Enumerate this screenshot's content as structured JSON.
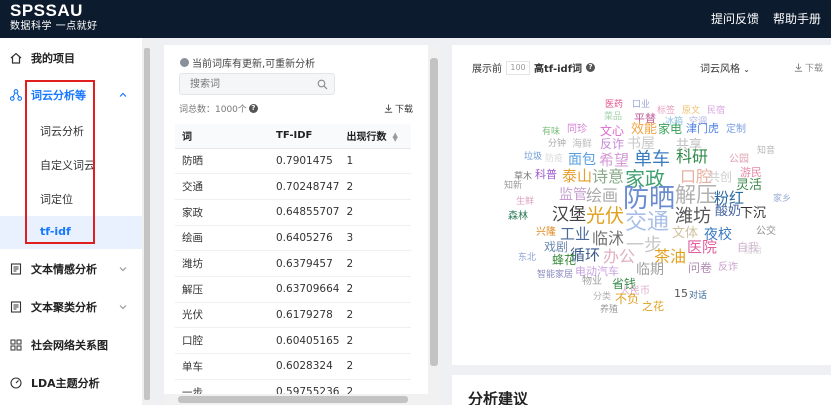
{
  "header": {
    "brand": "SPSSAU",
    "slogan": "数据科学 一点就好",
    "links": [
      "提问反馈",
      "帮助手册"
    ]
  },
  "sidebar": {
    "my_project": "我的项目",
    "group_active": "词云分析等",
    "sub_items": [
      "词云分析",
      "自定义词云",
      "词定位",
      "tf-idf"
    ],
    "groups": [
      "文本情感分析",
      "文本聚类分析",
      "社会网络关系图",
      "LDA主题分析"
    ]
  },
  "middle": {
    "notice": "当前词库有更新,可重新分析",
    "search_placeholder": "搜索词",
    "total": "词总数：1000个",
    "download": "下载",
    "columns": [
      "词",
      "TF-IDF",
      "出现行数"
    ],
    "rows": [
      [
        "防晒",
        "0.7901475",
        "1"
      ],
      [
        "交通",
        "0.70248747",
        "2"
      ],
      [
        "家政",
        "0.64855707",
        "2"
      ],
      [
        "绘画",
        "0.6405276",
        "3"
      ],
      [
        "潍坊",
        "0.6379457",
        "2"
      ],
      [
        "解压",
        "0.63709664",
        "2"
      ],
      [
        "光伏",
        "0.6179278",
        "2"
      ],
      [
        "口腔",
        "0.60405165",
        "2"
      ],
      [
        "单车",
        "0.6028324",
        "2"
      ],
      [
        "一步",
        "0.59755236",
        "2"
      ]
    ]
  },
  "right": {
    "show_prefix": "展示前",
    "show_count": "100",
    "show_suffix": "高tf-idf词",
    "style": "词云风格",
    "download": "下载",
    "analysis_title": "分析建议"
  },
  "cloud": {
    "words": [
      {
        "t": "医药",
        "c": "#e54d8a"
      },
      {
        "t": "口业",
        "c": "#9aa3d6"
      },
      {
        "t": "标签",
        "c": "#e9a0c0"
      },
      {
        "t": "原文",
        "c": "#f0c070"
      },
      {
        "t": "民宿",
        "c": "#d9a7e0"
      },
      {
        "t": "菜品",
        "c": "#a0d0a8"
      },
      {
        "t": "平替",
        "c": "#c05a9a"
      },
      {
        "t": "冰箱",
        "c": "#8fc2e0"
      },
      {
        "t": "空调",
        "c": "#b5b5e0"
      },
      {
        "t": "有味",
        "c": "#7fbf7f"
      },
      {
        "t": "同珍",
        "c": "#d37fd3"
      },
      {
        "t": "文心",
        "c": "#e06ad0"
      },
      {
        "t": "效能",
        "c": "#f2a340"
      },
      {
        "t": "家电",
        "c": "#3aa05a"
      },
      {
        "t": "津门虎",
        "c": "#4b7fe0"
      },
      {
        "t": "定制",
        "c": "#7a9fe0"
      },
      {
        "t": "分钟",
        "c": "#a7a7a7"
      },
      {
        "t": "海鲜",
        "c": "#bcbcbc"
      },
      {
        "t": "反诈",
        "c": "#c58ad8"
      },
      {
        "t": "书屋",
        "c": "#c9c9c9"
      },
      {
        "t": "共享",
        "c": "#bfbfbf"
      },
      {
        "t": "知音",
        "c": "#b8b8b8"
      },
      {
        "t": "垃圾",
        "c": "#6a9ad8"
      },
      {
        "t": "防疫",
        "c": "#dadada"
      },
      {
        "t": "面包",
        "c": "#5aa0e0"
      },
      {
        "t": "希望",
        "c": "#d59ad4"
      },
      {
        "t": "单车",
        "c": "#3a7ec0"
      },
      {
        "t": "科研",
        "c": "#2f8a4a"
      },
      {
        "t": "公园",
        "c": "#e0a0b0"
      },
      {
        "t": "草木",
        "c": "#777777"
      },
      {
        "t": "科普",
        "c": "#a05ad0"
      },
      {
        "t": "泰山",
        "c": "#e6a030"
      },
      {
        "t": "诗意",
        "c": "#8aaa8a"
      },
      {
        "t": "家政",
        "c": "#40a070"
      },
      {
        "t": "口腔",
        "c": "#e8b0a0"
      },
      {
        "t": "共创",
        "c": "#cccccc"
      },
      {
        "t": "游民",
        "c": "#e68aa8"
      },
      {
        "t": "灵活",
        "c": "#3a8a4a"
      },
      {
        "t": "知新",
        "c": "#999999"
      },
      {
        "t": "监管",
        "c": "#c8a0d0"
      },
      {
        "t": "绘画",
        "c": "#aaaaaa"
      },
      {
        "t": "防晒",
        "c": "#6a8cd0"
      },
      {
        "t": "解压",
        "c": "#b0b0b0"
      },
      {
        "t": "粉红",
        "c": "#2a6aa0"
      },
      {
        "t": "家乡",
        "c": "#9ab0d0"
      },
      {
        "t": "生鲜",
        "c": "#e0a0c0"
      },
      {
        "t": "光伏",
        "c": "#e0a020"
      },
      {
        "t": "交通",
        "c": "#a8c0e8"
      },
      {
        "t": "潍坊",
        "c": "#555555"
      },
      {
        "t": "酸奶",
        "c": "#4060a0"
      },
      {
        "t": "下沉",
        "c": "#333333"
      },
      {
        "t": "森林",
        "c": "#2f7a5a"
      },
      {
        "t": "汉堡",
        "c": "#444444"
      },
      {
        "t": "工业",
        "c": "#4a6a9a"
      },
      {
        "t": "临沭",
        "c": "#707070"
      },
      {
        "t": "一步",
        "c": "#c8c8c8"
      },
      {
        "t": "医院",
        "c": "#e060a0"
      },
      {
        "t": "文体",
        "c": "#d0c0a0"
      },
      {
        "t": "夜校",
        "c": "#3a7ac0"
      },
      {
        "t": "公交",
        "c": "#909090"
      },
      {
        "t": "兴隆",
        "c": "#e08a20"
      },
      {
        "t": "戏剧",
        "c": "#6a8ab0"
      },
      {
        "t": "循环",
        "c": "#3a5a8a"
      },
      {
        "t": "办公",
        "c": "#e0b0c0"
      },
      {
        "t": "茶油",
        "c": "#e0a020"
      },
      {
        "t": "自我",
        "c": "#d0b0d0"
      },
      {
        "t": "防治",
        "c": "#d8d8d8"
      },
      {
        "t": "东北",
        "c": "#8aa0d0"
      },
      {
        "t": "蜂花",
        "c": "#3a8a3a"
      },
      {
        "t": "临期",
        "c": "#a0a0a0"
      },
      {
        "t": "问卷",
        "c": "#b08ab0"
      },
      {
        "t": "反诈",
        "c": "#c8a0c8"
      },
      {
        "t": "电动汽车",
        "c": "#c8a0e0"
      },
      {
        "t": "智能家居",
        "c": "#8a8ac0"
      },
      {
        "t": "物业",
        "c": "#a0a0a0"
      },
      {
        "t": "省钱",
        "c": "#3a8a4a"
      },
      {
        "t": "人民币",
        "c": "#e0b0d0"
      },
      {
        "t": "15",
        "c": "#555555"
      },
      {
        "t": "对话",
        "c": "#3a6a9a"
      },
      {
        "t": "分类",
        "c": "#b0b0b0"
      },
      {
        "t": "不负",
        "c": "#e0a020"
      },
      {
        "t": "之花",
        "c": "#e0a020"
      },
      {
        "t": "养殖",
        "c": "#999999"
      }
    ]
  }
}
